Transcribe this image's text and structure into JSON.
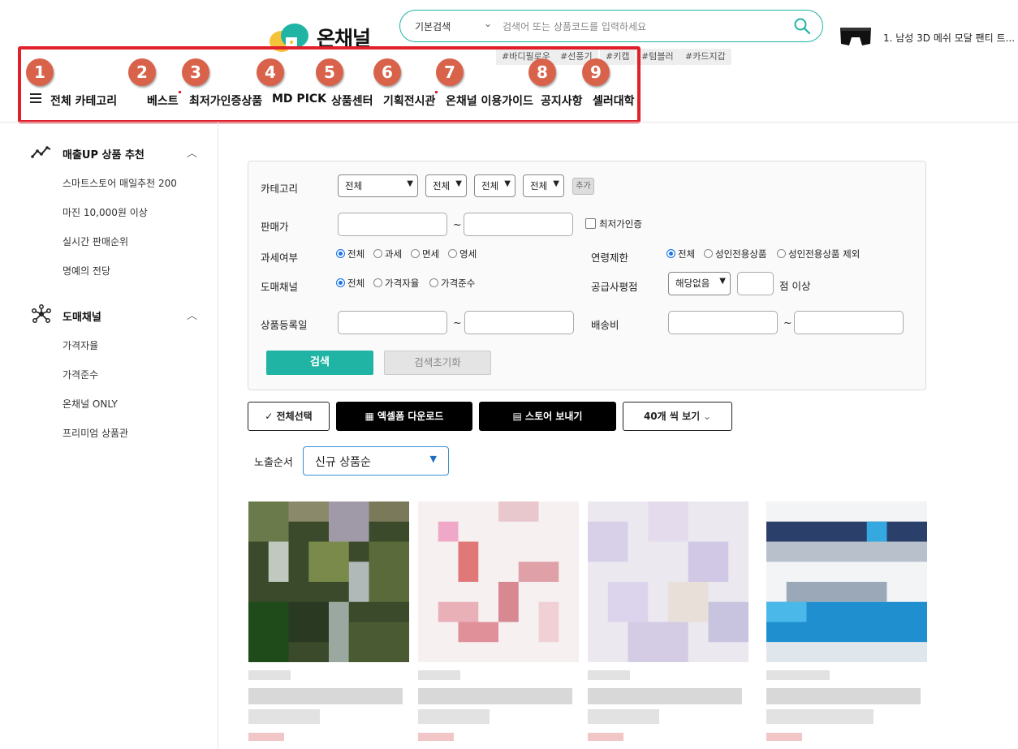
{
  "header": {
    "logo_text": "온채널",
    "search": {
      "scope": "기본검색",
      "placeholder": "검색어 또는 상품코드를 입력하세요"
    },
    "tags": [
      "#바디필로우",
      "#선풍기",
      "#키캡",
      "#텀블러",
      "#카드지갑"
    ],
    "ranking": "1. 남성 3D 메쉬 모달 팬티 트..."
  },
  "nav": {
    "all_category": "전체 카테고리",
    "items": [
      {
        "label": "베스트",
        "badge": "2"
      },
      {
        "label": "최저가인증상품",
        "badge": "3"
      },
      {
        "label": "MD PICK",
        "badge": "4"
      },
      {
        "label": "상품센터",
        "badge": "5"
      },
      {
        "label": "기획전시관",
        "badge": "6"
      },
      {
        "label": "온채널 이용가이드",
        "badge": "7"
      },
      {
        "label": "공지사항",
        "badge": "8"
      },
      {
        "label": "셀러대학",
        "badge": "9"
      }
    ],
    "first_badge": "1"
  },
  "sidebar": {
    "sections": [
      {
        "title": "매출UP 상품 추천",
        "items": [
          "스마트스토어 매일추천 200",
          "마진 10,000원 이상",
          "실시간 판매순위",
          "명예의 전당"
        ]
      },
      {
        "title": "도매채널",
        "items": [
          "가격자율",
          "가격준수",
          "온채널 ONLY",
          "프리미엄 상품관"
        ]
      }
    ]
  },
  "filter": {
    "category_label": "카테고리",
    "category_selects": [
      "전체",
      "전체",
      "전체",
      "전체"
    ],
    "add_label": "추가",
    "price_label": "판매가",
    "tilde": "~",
    "lowest_price_label": "최저가인증",
    "tax_label": "과세여부",
    "tax_options": [
      "전체",
      "과세",
      "면세",
      "영세"
    ],
    "age_label": "연령제한",
    "age_options": [
      "전체",
      "성인전용상품",
      "성인전용상품 제외"
    ],
    "channel_label": "도매채널",
    "channel_options": [
      "전체",
      "가격자율",
      "가격준수"
    ],
    "rating_label": "공급사평점",
    "rating_select": "해당없음",
    "rating_suffix": "점 이상",
    "date_label": "상품등록일",
    "shipping_label": "배송비",
    "search_button": "검색",
    "reset_button": "검색초기화"
  },
  "actions": {
    "select_all": "전체선택",
    "excel": "엑셀폼 다운로드",
    "send_store": "스토어 보내기",
    "per_page": "40개 씩 보기"
  },
  "sort": {
    "label": "노출순서",
    "value": "신규 상품순"
  },
  "colors": {
    "accent": "#1fb4a3",
    "highlight": "#e0202a",
    "badge": "#d9624a"
  }
}
